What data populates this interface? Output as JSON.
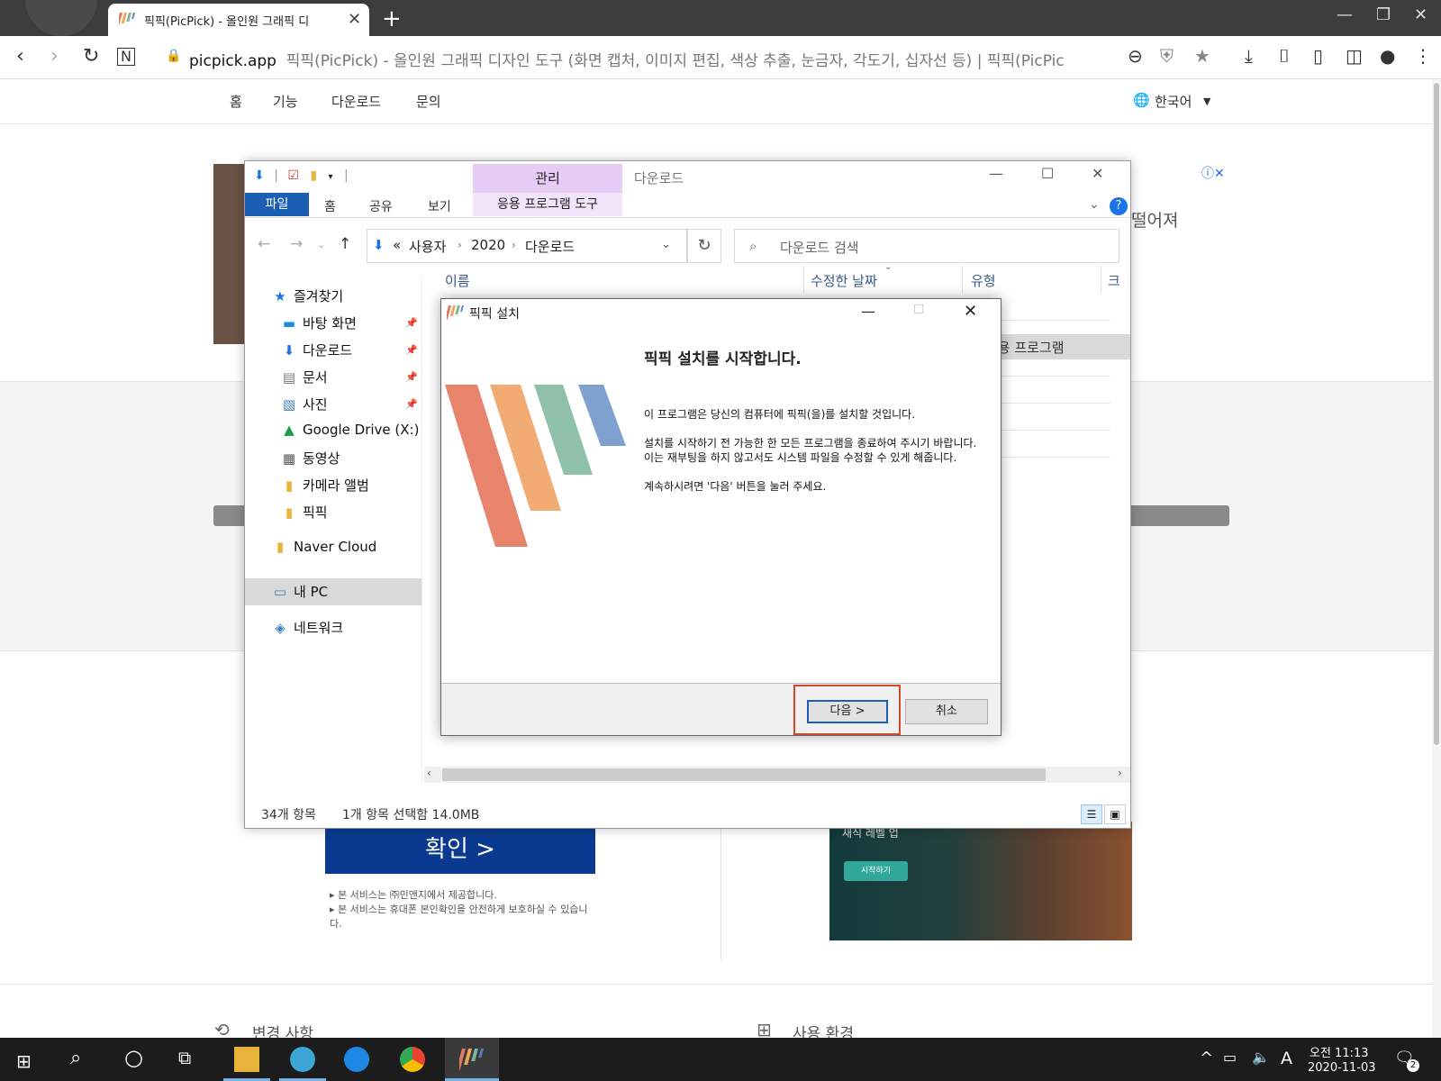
{
  "browser": {
    "tab_title": "픽픽(PicPick) - 올인원 그래픽 디",
    "url_host": "picpick.app",
    "url_rest": "픽픽(PicPick) - 올인원 그래픽 디자인 도구 (화면 캡처, 이미지 편집, 색상 추출, 눈금자, 각도기, 십자선 등) | 픽픽(PicPic"
  },
  "site": {
    "nav": [
      "홈",
      "기능",
      "다운로드",
      "문의"
    ],
    "language": "한국어",
    "ad_text": "떨어져",
    "confirm_button": "확인 >",
    "service_notes": [
      "본 서비스는 ㈜민앤지에서 제공합니다.",
      "본 서비스는 휴대폰 본인확인을 안전하게 보호하실 수 있습니다."
    ],
    "game_sub": "새식 레벨 업",
    "game_button": "시작하기",
    "changelog": "변경 사항",
    "requirements": "사용 환경"
  },
  "explorer": {
    "title": "다운로드",
    "manage_tab": "관리",
    "app_tools_tab": "응용 프로그램 도구",
    "ribbon_tabs": [
      "파일",
      "홈",
      "공유",
      "보기"
    ],
    "path": {
      "prefix": "«",
      "items": [
        "사용자",
        "2020",
        "다운로드"
      ]
    },
    "search_placeholder": "다운로드 검색",
    "sidebar": {
      "quick_access": "즐겨찾기",
      "items": [
        "바탕 화면",
        "다운로드",
        "문서",
        "사진",
        "Google Drive (X:)",
        "동영상",
        "카메라 앨범",
        "픽픽"
      ],
      "naver": "Naver Cloud",
      "this_pc": "내 PC",
      "network": "네트워크"
    },
    "columns": [
      "이름",
      "수정한 날짜",
      "유형",
      "크"
    ],
    "selected_type": "응용 프로그램",
    "status_count": "34개 항목",
    "status_selected": "1개 항목 선택함 14.0MB"
  },
  "installer": {
    "title": "픽픽 설치",
    "heading": "픽픽 설치를 시작합니다.",
    "paragraphs": [
      "이 프로그램은 당신의 컴퓨터에 픽픽(을)를 설치할 것입니다.",
      "설치를 시작하기 전 가능한 한 모든 프로그램을 종료하여 주시기 바랍니다. 이는 재부팅을 하지 않고서도 시스템 파일을 수정할 수 있게 해줍니다.",
      "계속하시려면 '다음' 버튼을 눌러 주세요."
    ],
    "next_button": "다음 >",
    "cancel_button": "취소"
  },
  "taskbar": {
    "ime": "A",
    "time": "오전 11:13",
    "date": "2020-11-03",
    "notification_count": "2"
  }
}
